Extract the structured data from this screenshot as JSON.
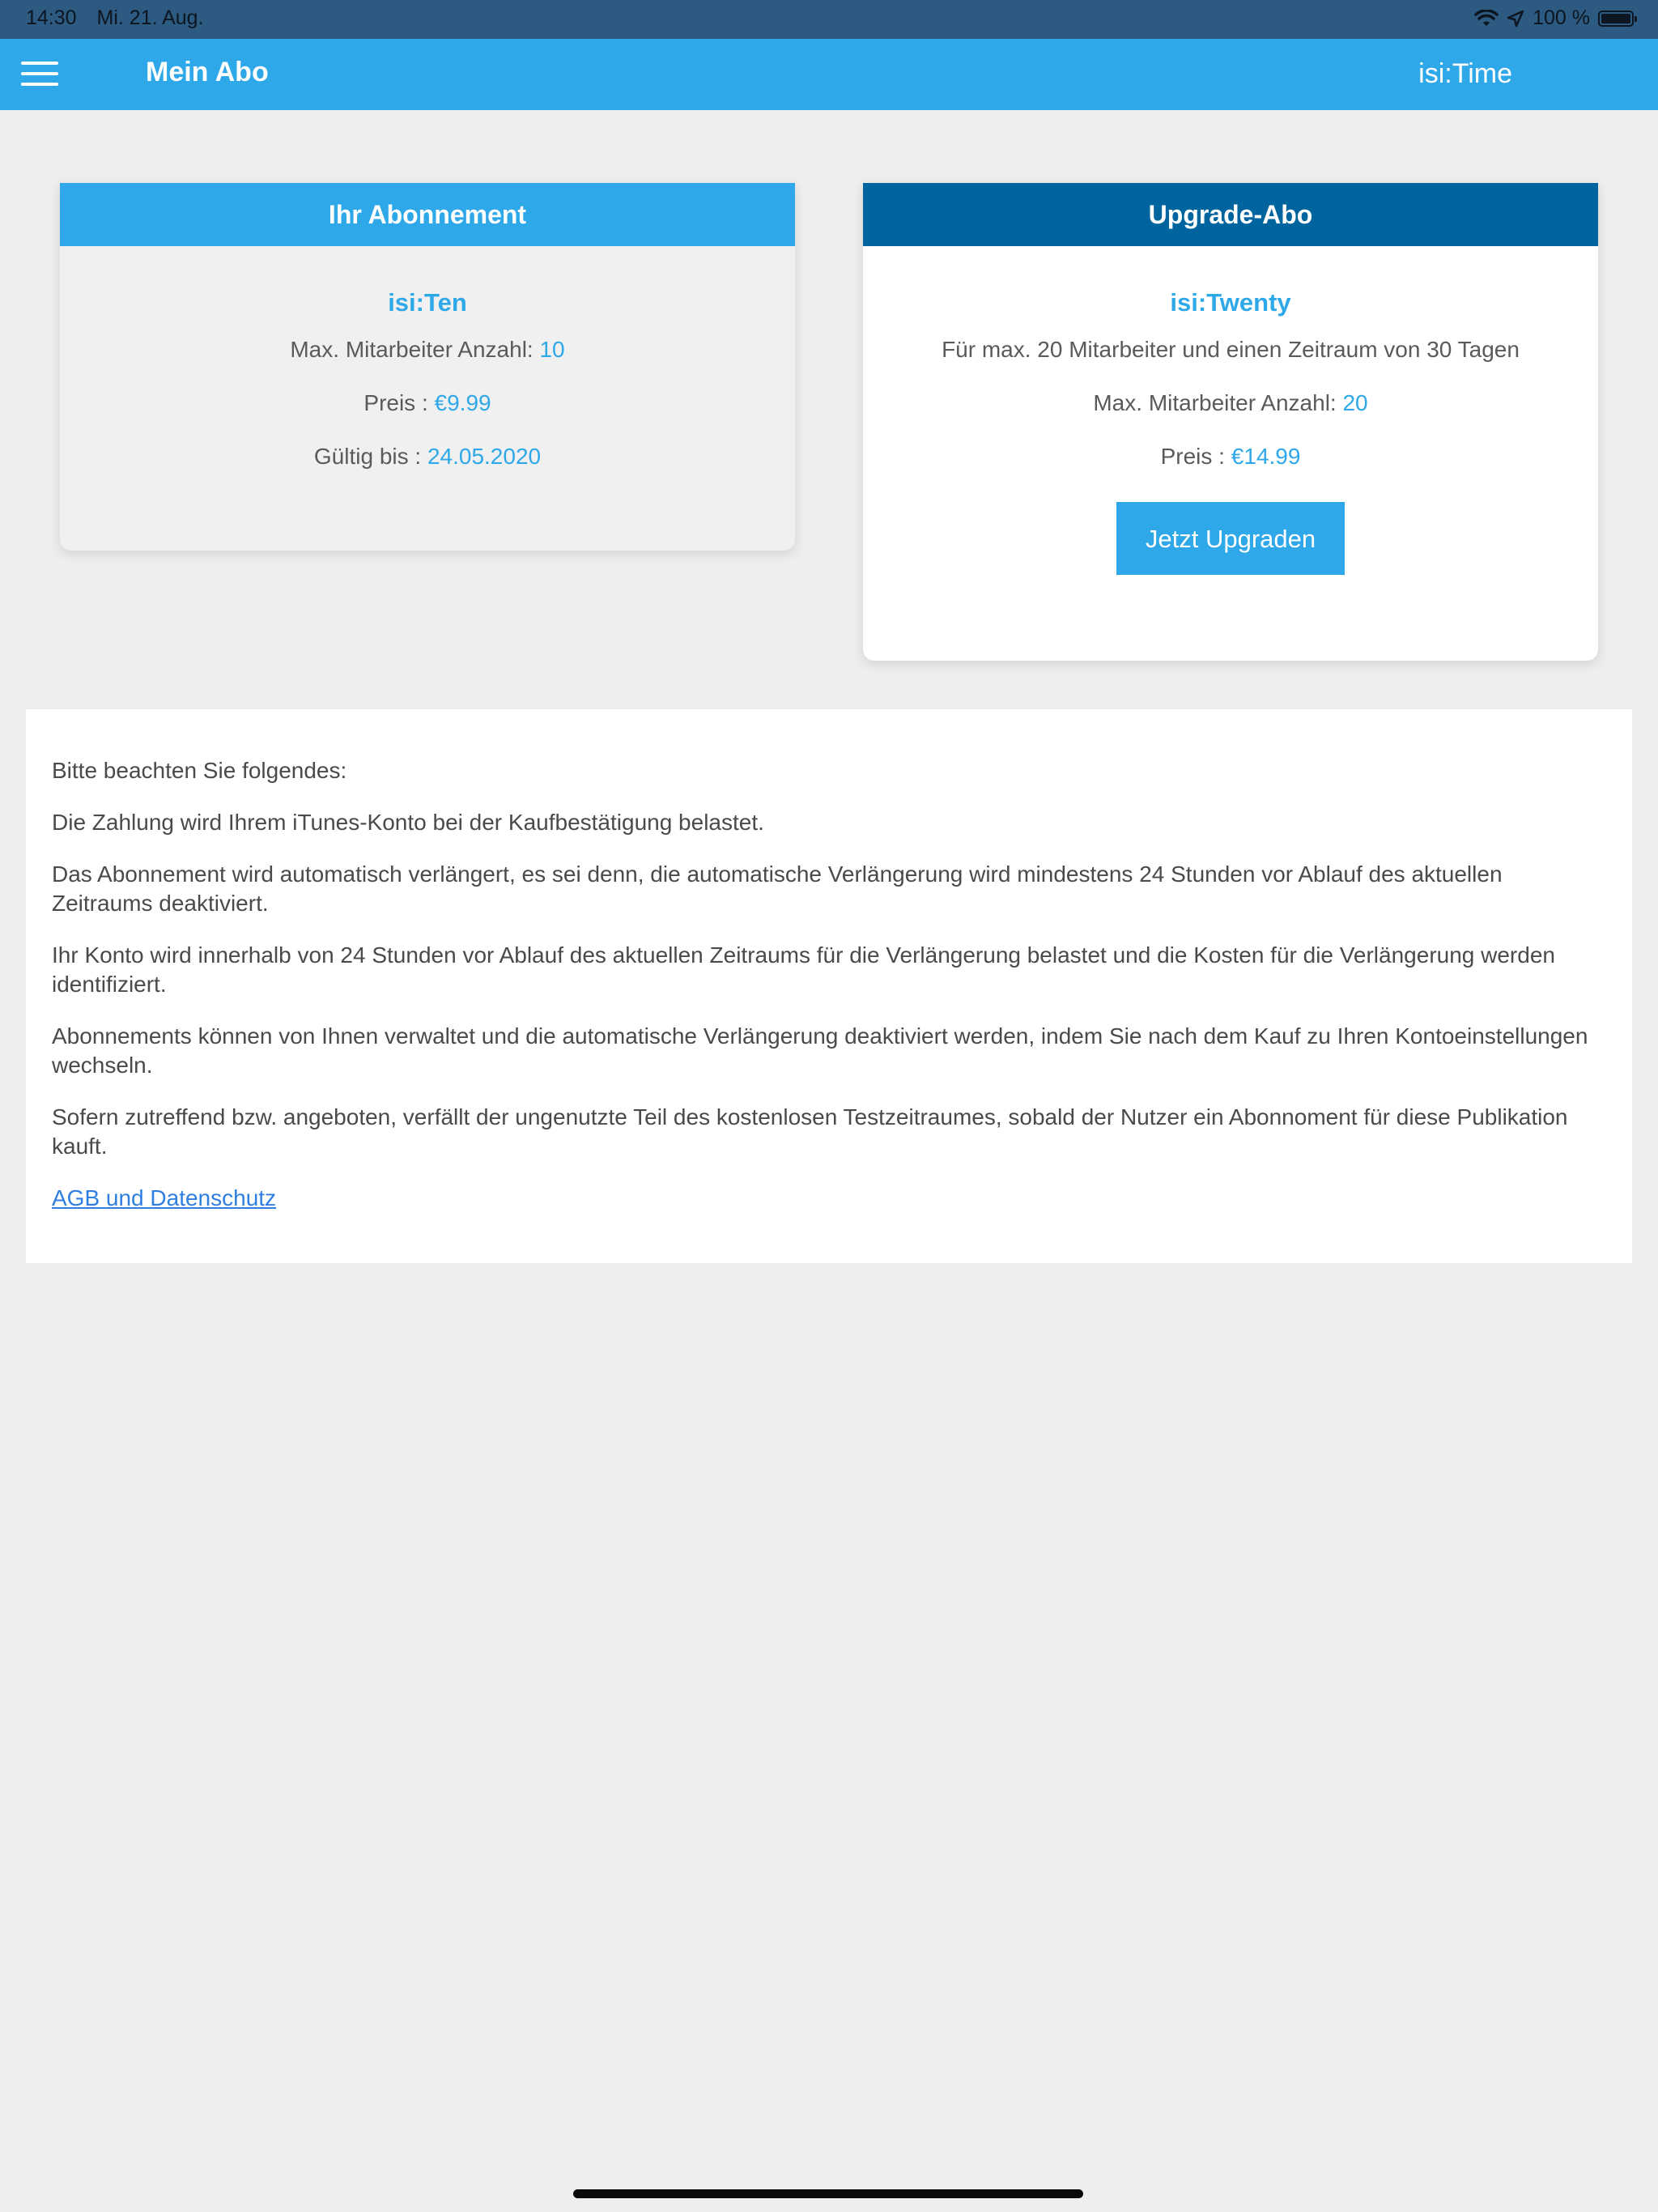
{
  "status_bar": {
    "time": "14:30",
    "date": "Mi. 21. Aug.",
    "battery": "100 %",
    "wifi_icon": "wifi-icon",
    "location_icon": "location-arrow-icon",
    "battery_icon": "battery-icon"
  },
  "header": {
    "title": "Mein Abo",
    "app_name": "isi:Time",
    "menu_icon": "hamburger-menu-icon",
    "background": "#2ea8e8"
  },
  "current_plan": {
    "heading": "Ihr Abonnement",
    "name": "isi:Ten",
    "max_employees_label": "Max. Mitarbeiter Anzahl: ",
    "max_employees_value": "10",
    "price_label": "Preis : ",
    "price_value": "€9.99",
    "valid_until_label": "Gültig bis : ",
    "valid_until_value": "24.05.2020"
  },
  "upgrade_plan": {
    "heading": "Upgrade-Abo",
    "name": "isi:Twenty",
    "description": "Für max. 20 Mitarbeiter und einen Zeitraum von 30 Tagen",
    "max_employees_label": "Max. Mitarbeiter Anzahl: ",
    "max_employees_value": "20",
    "price_label": "Preis : ",
    "price_value": "€14.99",
    "button_label": "Jetzt Upgraden",
    "header_background": "#00659f"
  },
  "notice": {
    "paragraphs": [
      "Bitte beachten Sie folgendes:",
      "Die Zahlung wird Ihrem iTunes-Konto bei der Kaufbestätigung belastet.",
      "Das Abonnement wird automatisch verlängert, es sei denn, die automatische Verlängerung wird mindestens 24 Stunden vor Ablauf des aktuellen Zeitraums deaktiviert.",
      "Ihr Konto wird innerhalb von 24 Stunden vor Ablauf des aktuellen Zeitraums für die Verlängerung belastet und die Kosten für die Verlängerung werden identifiziert.",
      "Abonnements können von Ihnen verwaltet und die automatische Verlängerung deaktiviert werden, indem Sie nach dem Kauf zu Ihren Kontoeinstellungen wechseln.",
      "Sofern zutreffend bzw. angeboten, verfällt der ungenutzte Teil des kostenlosen Testzeitraumes, sobald der Nutzer ein Abonnoment für diese Publikation kauft."
    ],
    "link_label": "AGB und Datenschutz"
  }
}
